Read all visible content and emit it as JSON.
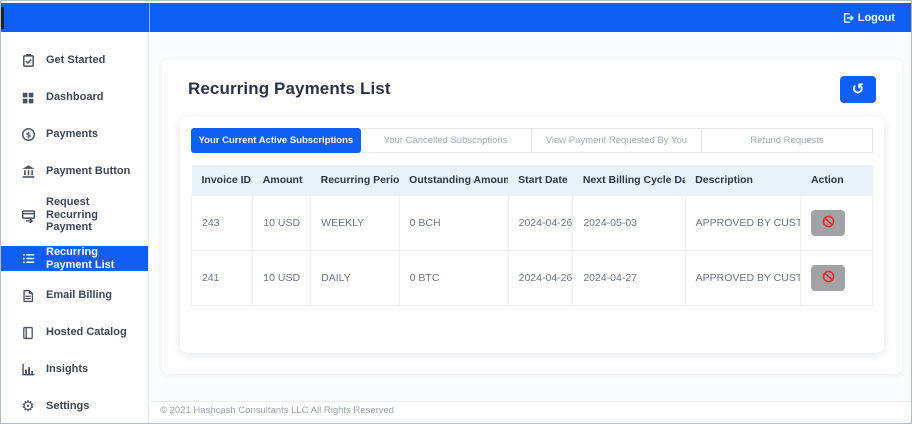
{
  "topbar": {
    "logout_label": "Logout"
  },
  "sidebar": {
    "items": [
      {
        "label": "Get Started",
        "icon": "clipboard-icon",
        "active": false
      },
      {
        "label": "Dashboard",
        "icon": "grid-icon",
        "active": false
      },
      {
        "label": "Payments",
        "icon": "dollar-circle-icon",
        "active": false
      },
      {
        "label": "Payment Button",
        "icon": "bank-icon",
        "active": false
      },
      {
        "label": "Request Recurring Payment",
        "icon": "card-arrow-icon",
        "active": false
      },
      {
        "label": "Recurring Payment List",
        "icon": "list-icon",
        "active": true
      },
      {
        "label": "Email Billing",
        "icon": "document-icon",
        "active": false
      },
      {
        "label": "Hosted Catalog",
        "icon": "book-icon",
        "active": false
      },
      {
        "label": "Insights",
        "icon": "chart-icon",
        "active": false
      },
      {
        "label": "Settings",
        "icon": "gear-icon",
        "active": false
      }
    ]
  },
  "main": {
    "title": "Recurring Payments List",
    "history_button_icon": "history-icon",
    "history_glyph": "↺",
    "gear_glyph": "⚙",
    "tabs": [
      {
        "label": "Your Current Active Subscriptions",
        "active": true
      },
      {
        "label": "Your Cancelled Subscriptions",
        "active": false
      },
      {
        "label": "View Payment Requested By You",
        "active": false
      },
      {
        "label": "Refund Requests",
        "active": false
      }
    ],
    "table": {
      "columns": [
        "Invoice ID",
        "Amount",
        "Recurring Period",
        "Outstanding Amount",
        "Start Date",
        "Next Billing Cycle Date",
        "Description",
        "Action"
      ],
      "rows": [
        {
          "invoice_id": "243",
          "amount": "10 USD",
          "recurring_period": "WEEKLY",
          "outstanding_amount": "0 BCH",
          "start_date": "2024-04-26",
          "next_billing_cycle_date": "2024-05-03",
          "description": "APPROVED BY CUSTOMER",
          "action_icon": "block-icon"
        },
        {
          "invoice_id": "241",
          "amount": "10 USD",
          "recurring_period": "DAILY",
          "outstanding_amount": "0 BTC",
          "start_date": "2024-04-26",
          "next_billing_cycle_date": "2024-04-27",
          "description": "APPROVED BY CUSTOMER",
          "action_icon": "block-icon"
        }
      ]
    }
  },
  "footer": {
    "copyright": "© 2021 Hashcash Consultants LLC All Rights Reserved"
  },
  "colors": {
    "primary_blue": "#0d5ef4",
    "table_header_bg": "#e9f1fb",
    "action_button_gray": "#a3a3a5",
    "block_icon_red": "#e23131",
    "sidebar_text": "#3e4656",
    "muted_text": "#6d7584"
  }
}
